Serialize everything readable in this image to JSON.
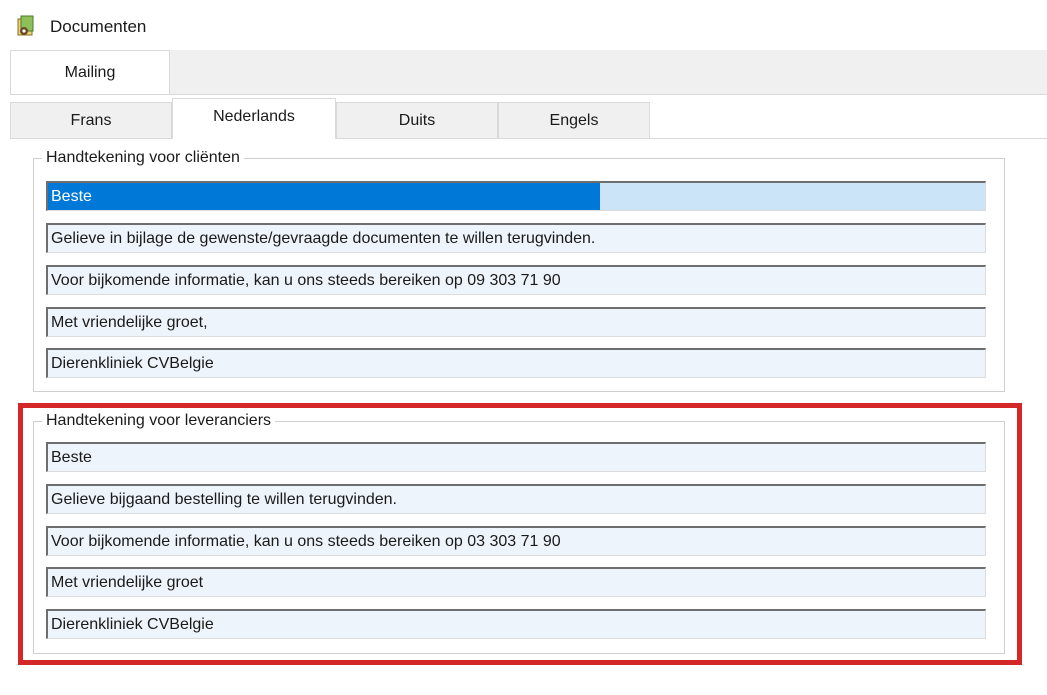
{
  "window": {
    "title": "Documenten",
    "icon": "app-documents-icon"
  },
  "outer_tabs": [
    {
      "label": "Mailing",
      "active": true
    }
  ],
  "inner_tabs": [
    {
      "label": "Frans",
      "active": false
    },
    {
      "label": "Nederlands",
      "active": true
    },
    {
      "label": "Duits",
      "active": false
    },
    {
      "label": "Engels",
      "active": false
    }
  ],
  "clients": {
    "legend": "Handtekening voor cliënten",
    "lines": [
      "Beste",
      "Gelieve in bijlage de gewenste/gevraagde documenten te willen terugvinden.",
      "Voor bijkomende informatie, kan u ons steeds bereiken op 09 303 71 90",
      "Met vriendelijke groet,",
      "Dierenkliniek CVBelgie"
    ]
  },
  "suppliers": {
    "legend": "Handtekening voor leveranciers",
    "lines": [
      "Beste",
      "Gelieve bijgaand bestelling te willen terugvinden.",
      "Voor bijkomende informatie, kan u ons steeds bereiken op 03 303 71 90",
      "Met vriendelijke groet",
      "Dierenkliniek CVBelgie"
    ]
  },
  "colors": {
    "highlight_frame": "#d42727",
    "selection": "#0078d7",
    "field_bg": "#eef4fb"
  }
}
